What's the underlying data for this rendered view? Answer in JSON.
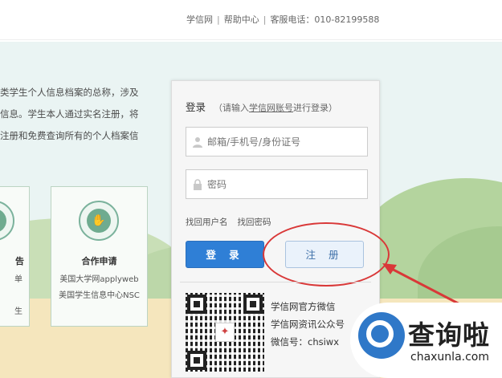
{
  "topnav": {
    "site": "学信网",
    "help": "帮助中心",
    "phone": "客服电话：010-82199588",
    "separator": "|"
  },
  "intro": {
    "lines": [
      "类学生个人信息档案的总称，涉及",
      "信息。学生本人通过实名注册，将",
      "注册和免费查询所有的个人档案信"
    ]
  },
  "cards": {
    "left": {
      "title": "告",
      "lines": [
        "单",
        "生"
      ]
    },
    "cooperation": {
      "title": "合作申请",
      "lines": [
        "美国大学网applyweb",
        "美国学生信息中心NSC"
      ]
    }
  },
  "login": {
    "title": "登录",
    "hint_prefix": "（请输入",
    "hint_link": "学信网账号",
    "hint_suffix": "进行登录）",
    "account_placeholder": "邮箱/手机号/身份证号",
    "password_placeholder": "密码",
    "find_username": "找回用户名",
    "find_password": "找回密码",
    "login_button": "登 录",
    "register_button": "注 册"
  },
  "wechat": {
    "line1": "学信网官方微信",
    "line2": "学信网资讯公众号",
    "line3": "微信号：chsiwx"
  },
  "watermark": {
    "brand": "查询啦",
    "domain": "chaxunla.com"
  },
  "icons": {
    "user": "user-icon",
    "lock": "lock-icon",
    "qr": "qr-code-icon",
    "handshake": "handshake-icon"
  },
  "colors": {
    "login_button": "#2f7fd6",
    "annotation_red": "#d93838",
    "hero_bg": "#eaf4f3",
    "card_border": "#bcd4c3"
  }
}
